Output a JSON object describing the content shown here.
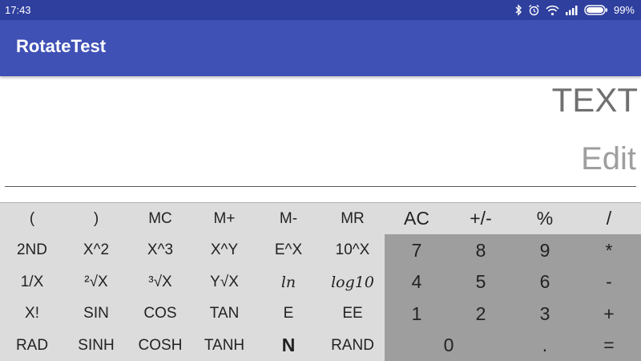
{
  "status_bar": {
    "time": "17:43",
    "battery": "99%",
    "icons": [
      "bluetooth-icon",
      "alarm-icon",
      "wifi-icon",
      "signal-icon",
      "battery-icon"
    ]
  },
  "app_bar": {
    "title": "RotateTest",
    "color": "#3f51b5"
  },
  "display": {
    "text": "TEXT",
    "edit_placeholder": "Edit"
  },
  "keypad": {
    "scientific_rows": [
      [
        "(",
        ")",
        "MC",
        "M+",
        "M-",
        "MR"
      ],
      [
        "2ND",
        "X^2",
        "X^3",
        "X^Y",
        "E^X",
        "10^X"
      ],
      [
        "1/X",
        "²√X",
        "³√X",
        "Y√X",
        "ln",
        "log10"
      ],
      [
        "X!",
        "SIN",
        "COS",
        "TAN",
        "E",
        "EE"
      ],
      [
        "RAD",
        "SINH",
        "COSH",
        "TANH",
        "N",
        "RAND"
      ]
    ],
    "top_ops": [
      "AC",
      "+/-",
      "%",
      "/"
    ],
    "numbers": [
      [
        "7",
        "8",
        "9",
        "*"
      ],
      [
        "4",
        "5",
        "6",
        "-"
      ],
      [
        "1",
        "2",
        "3",
        "+"
      ]
    ],
    "bottom": [
      "0",
      ".",
      "="
    ]
  }
}
